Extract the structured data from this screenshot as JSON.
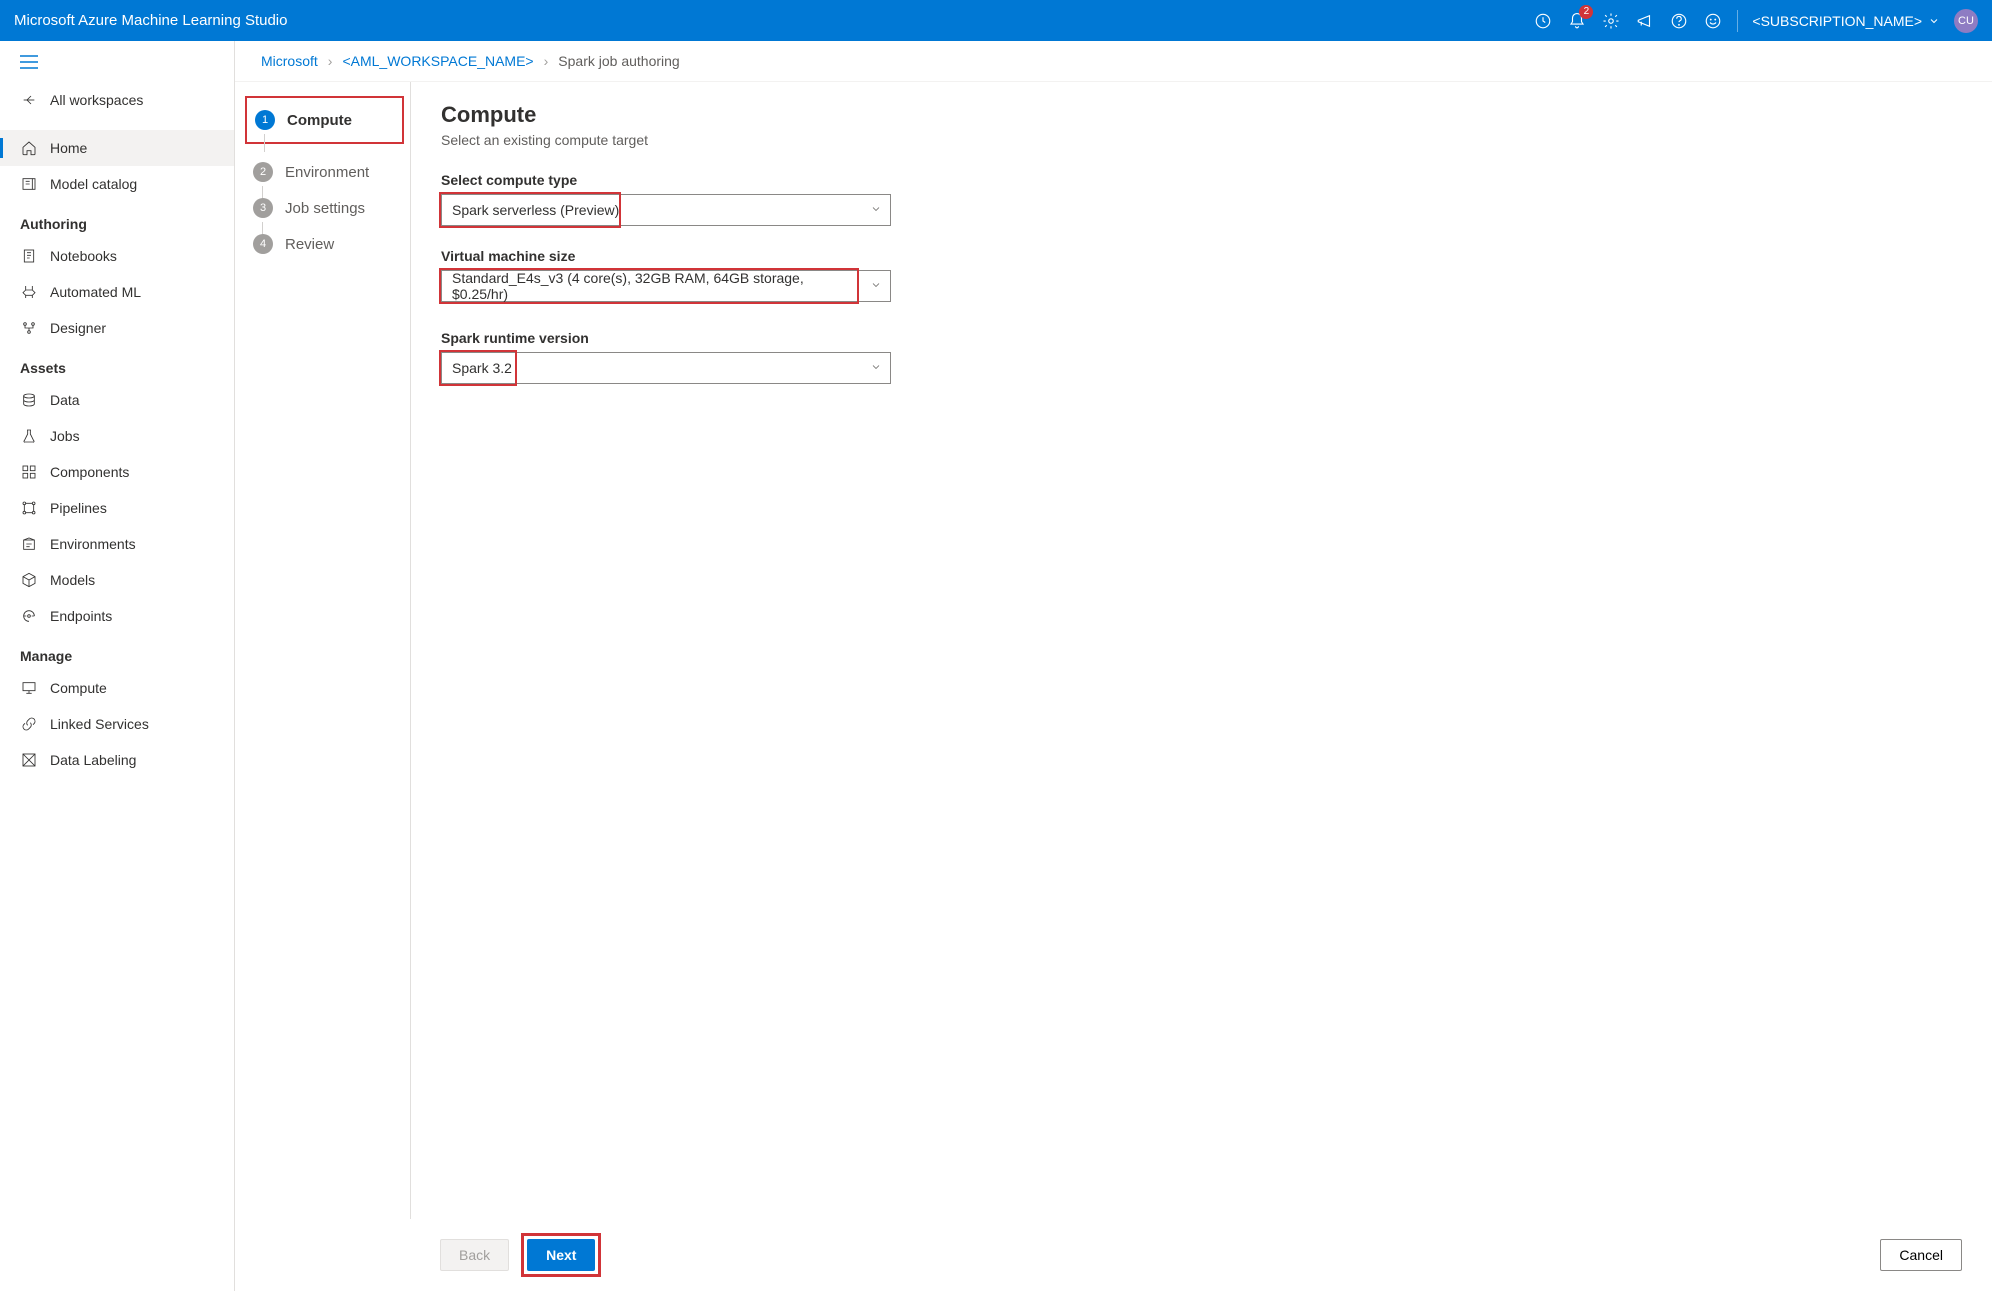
{
  "topbar": {
    "title": "Microsoft Azure Machine Learning Studio",
    "notification_count": "2",
    "subscription": "<SUBSCRIPTION_NAME>",
    "avatar": "CU"
  },
  "sidebar": {
    "all_workspaces": "All workspaces",
    "home": "Home",
    "model_catalog": "Model catalog",
    "section_authoring": "Authoring",
    "notebooks": "Notebooks",
    "automated_ml": "Automated ML",
    "designer": "Designer",
    "section_assets": "Assets",
    "data": "Data",
    "jobs": "Jobs",
    "components": "Components",
    "pipelines": "Pipelines",
    "environments": "Environments",
    "models": "Models",
    "endpoints": "Endpoints",
    "section_manage": "Manage",
    "compute": "Compute",
    "linked_services": "Linked Services",
    "data_labeling": "Data Labeling"
  },
  "breadcrumb": {
    "root": "Microsoft",
    "workspace": "<AML_WORKSPACE_NAME>",
    "current": "Spark job authoring"
  },
  "stepper": {
    "s1": "Compute",
    "s2": "Environment",
    "s3": "Job settings",
    "s4": "Review",
    "n1": "1",
    "n2": "2",
    "n3": "3",
    "n4": "4"
  },
  "form": {
    "title": "Compute",
    "subtitle": "Select an existing compute target",
    "compute_type_label": "Select compute type",
    "compute_type_value": "Spark serverless (Preview)",
    "vm_size_label": "Virtual machine size",
    "vm_size_value": "Standard_E4s_v3 (4 core(s), 32GB RAM, 64GB storage, $0.25/hr)",
    "runtime_label": "Spark runtime version",
    "runtime_value": "Spark 3.2"
  },
  "footer": {
    "back": "Back",
    "next": "Next",
    "cancel": "Cancel"
  }
}
